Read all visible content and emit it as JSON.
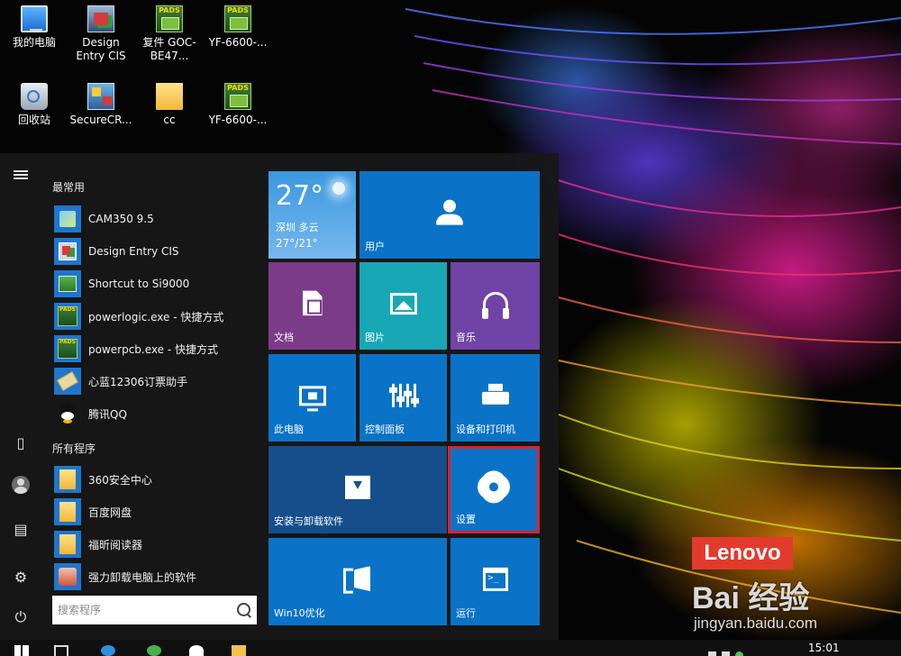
{
  "desktop": {
    "icons": [
      {
        "label": "我的电脑",
        "icon": "computer-icon"
      },
      {
        "label": "Design Entry CIS",
        "icon": "cis-app-icon"
      },
      {
        "label": "复件 GOC-BE47...",
        "icon": "pads-icon"
      },
      {
        "label": "YF-6600-...",
        "icon": "pads-icon"
      },
      {
        "label": "回收站",
        "icon": "recycle-bin-icon"
      },
      {
        "label": "SecureCR...",
        "icon": "securecrt-icon"
      },
      {
        "label": "cc",
        "icon": "folder-icon"
      },
      {
        "label": "YF-6600-...",
        "icon": "pads-icon"
      }
    ]
  },
  "start_menu": {
    "most_used_header": "最常用",
    "most_used": [
      {
        "label": "CAM350 9.5",
        "icon": "cam350-icon"
      },
      {
        "label": "Design Entry CIS",
        "icon": "cis-app-icon"
      },
      {
        "label": "Shortcut to Si9000",
        "icon": "si9000-icon"
      },
      {
        "label": "powerlogic.exe - 快捷方式",
        "icon": "pads-icon"
      },
      {
        "label": "powerpcb.exe - 快捷方式",
        "icon": "pads-icon"
      },
      {
        "label": "心蓝12306订票助手",
        "icon": "ticket-icon"
      },
      {
        "label": "腾讯QQ",
        "icon": "qq-icon"
      }
    ],
    "all_programs_header": "所有程序",
    "all_programs": [
      {
        "label": "360安全中心",
        "icon": "folder-icon"
      },
      {
        "label": "百度网盘",
        "icon": "folder-icon"
      },
      {
        "label": "福昕阅读器",
        "icon": "folder-icon"
      },
      {
        "label": "强力卸载电脑上的软件",
        "icon": "uninstaller-icon"
      }
    ],
    "search": {
      "placeholder": "搜索程序"
    },
    "tiles": {
      "weather": {
        "temp": "27°",
        "city": "深圳  多云",
        "range": "27°/21°"
      },
      "user": "用户",
      "documents": "文档",
      "pictures": "图片",
      "music": "音乐",
      "this_pc": "此电脑",
      "control_panel": "控制面板",
      "devices_printers": "设备和打印机",
      "install_uninstall": "安装与卸载软件",
      "settings": "设置",
      "win10_optimize": "Win10优化",
      "run": "运行"
    },
    "highlight_color": "#e0212e"
  },
  "watermark": {
    "lenovo": "Lenovo",
    "baidu": "Bai 经验",
    "url": "jingyan.baidu.com"
  },
  "taskbar": {
    "clock": "15:01"
  }
}
